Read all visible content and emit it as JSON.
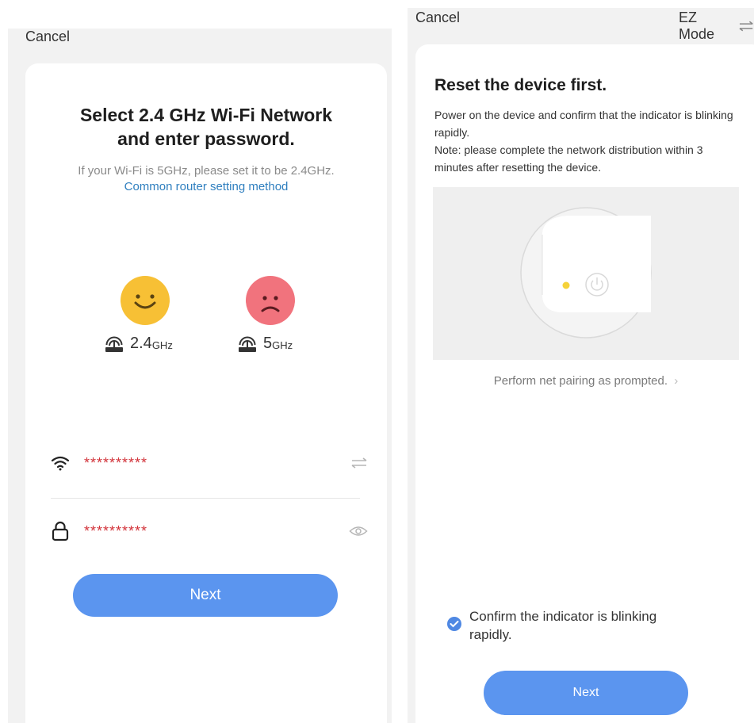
{
  "left_screen": {
    "cancel_label": "Cancel",
    "title_line1": "Select 2.4 GHz Wi-Fi Network",
    "title_line2": "and enter password.",
    "hint_text": "If your Wi-Fi is 5GHz, please set it to be 2.4GHz.",
    "hint_link": "Common router setting method",
    "band_good": {
      "value": "2.4",
      "unit": "GHz"
    },
    "band_bad": {
      "value": "5",
      "unit": "GHz"
    },
    "wifi_value": "**********",
    "password_value": "**********",
    "next_label": "Next"
  },
  "right_screen": {
    "cancel_label": "Cancel",
    "mode_label": "EZ Mode",
    "title": "Reset the device first.",
    "body_line1": "Power on the device and confirm that the indicator is blinking rapidly.",
    "body_line2": "Note: please complete the network distribution within 3 minutes after resetting the device.",
    "pairing_link": "Perform net pairing as prompted.",
    "confirm_text": "Confirm the indicator is blinking rapidly.",
    "confirm_checked": true,
    "next_label": "Next"
  },
  "colors": {
    "accent": "#5b95ef",
    "link": "#2f7fbf",
    "password_text": "#d2333a",
    "happy_face": "#f7c035",
    "sad_face": "#f1737d",
    "indicator": "#f5d23a"
  },
  "icons": [
    "wifi-icon",
    "lock-icon",
    "swap-icon",
    "eye-icon",
    "router-icon",
    "power-icon",
    "check-icon",
    "chevron-right-icon"
  ]
}
